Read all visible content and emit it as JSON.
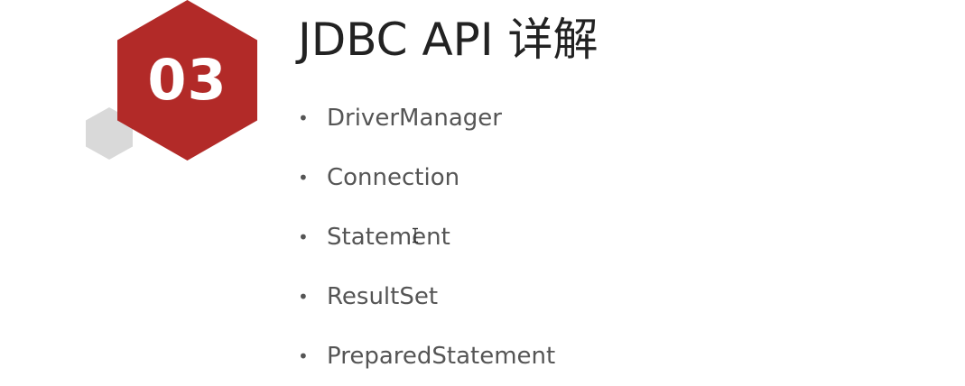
{
  "slide": {
    "badge_number": "03",
    "title": "JDBC API 详解",
    "items": [
      "DriverManager",
      "Connection",
      "Statement",
      "ResultSet",
      "PreparedStatement"
    ],
    "bullet_symbol": "•"
  },
  "colors": {
    "badge_red": "#b22a28",
    "small_hex_gray": "#d9d9d9",
    "title_text": "#222222",
    "list_text": "#555555"
  },
  "icons": {
    "cursor": "text-cursor-icon"
  }
}
